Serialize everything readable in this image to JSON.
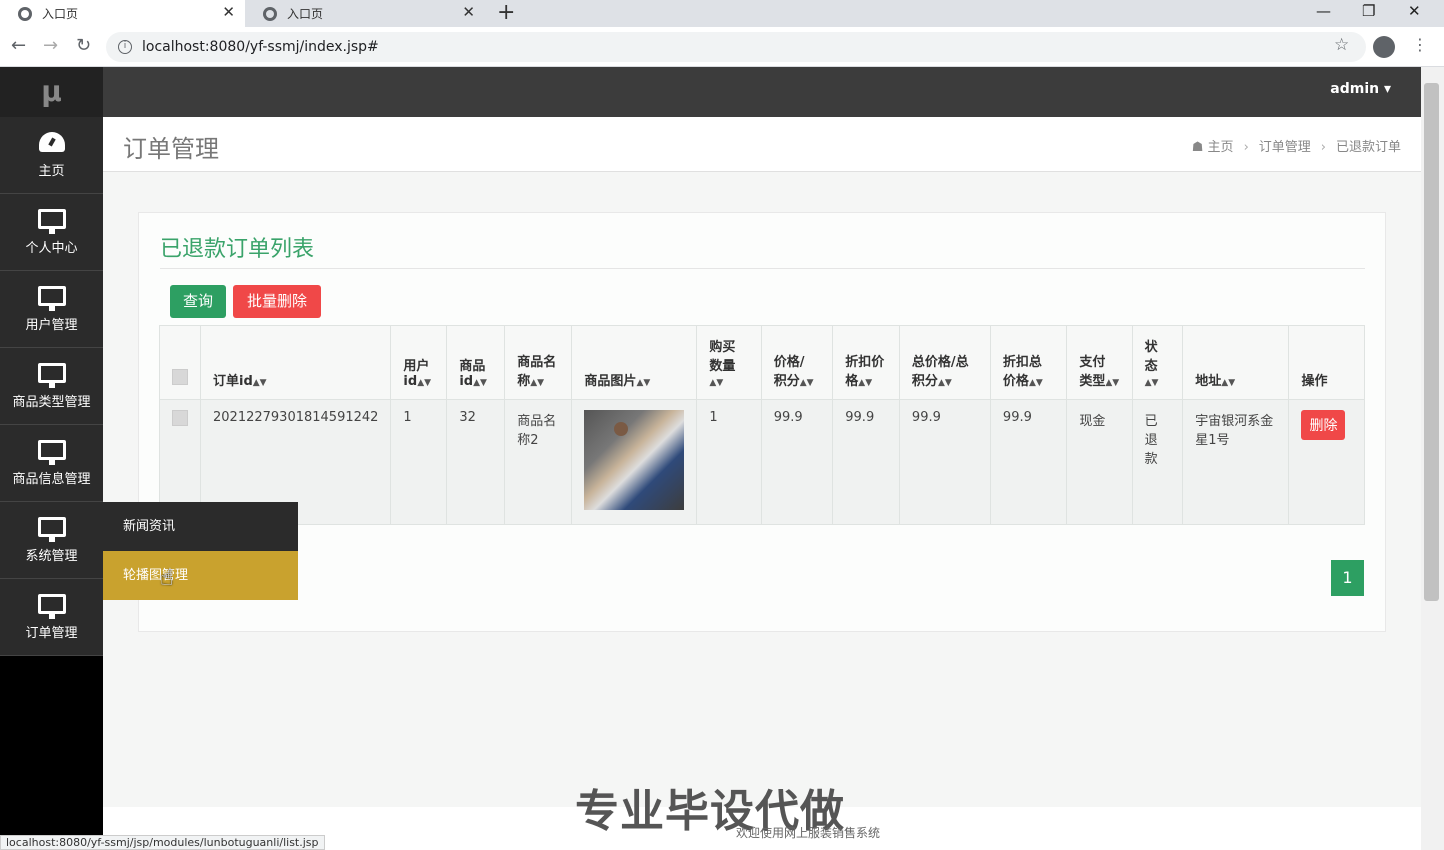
{
  "browser": {
    "tabs": [
      {
        "label": "入口页"
      },
      {
        "label": "入口页"
      }
    ],
    "url": "localhost:8080/yf-ssmj/index.jsp#",
    "status_url": "localhost:8080/yf-ssmj/jsp/modules/lunbotuguanli/list.jsp"
  },
  "sidebar": {
    "logo": "μ",
    "items": [
      {
        "label": "主页",
        "icon": "dashboard-icon"
      },
      {
        "label": "个人中心",
        "icon": "monitor-icon"
      },
      {
        "label": "用户管理",
        "icon": "monitor-icon"
      },
      {
        "label": "商品类型管理",
        "icon": "monitor-icon"
      },
      {
        "label": "商品信息管理",
        "icon": "monitor-icon"
      },
      {
        "label": "系统管理",
        "icon": "monitor-icon"
      },
      {
        "label": "订单管理",
        "icon": "monitor-icon"
      }
    ],
    "submenu": [
      {
        "label": "新闻资讯"
      },
      {
        "label": "轮播图管理"
      }
    ]
  },
  "topnav": {
    "user": "admin ▾"
  },
  "page": {
    "title": "订单管理",
    "breadcrumb": [
      "主页",
      "订单管理",
      "已退款订单"
    ]
  },
  "card": {
    "title": "已退款订单列表",
    "query_button": "查询",
    "batch_delete_button": "批量删除"
  },
  "table": {
    "headers": [
      {
        "l1": "订单id",
        "l2": ""
      },
      {
        "l1": "用户",
        "l2": "id"
      },
      {
        "l1": "商品",
        "l2": "id"
      },
      {
        "l1": "商品名",
        "l2": "称"
      },
      {
        "l1": "商品图片",
        "l2": ""
      },
      {
        "l1": "购买",
        "l2": "数量"
      },
      {
        "l1": "价格/",
        "l2": "积分"
      },
      {
        "l1": "折扣价",
        "l2": "格"
      },
      {
        "l1": "总价格/总",
        "l2": "积分"
      },
      {
        "l1": "折扣总",
        "l2": "价格"
      },
      {
        "l1": "支付",
        "l2": "类型"
      },
      {
        "l1": "状",
        "l2": "态"
      },
      {
        "l1": "地址",
        "l2": ""
      },
      {
        "l1": "操作",
        "l2": ""
      }
    ],
    "rows": [
      {
        "order_id": "20212279301814591242",
        "user_id": "1",
        "product_id": "32",
        "product_name": "商品名称2",
        "quantity": "1",
        "price": "99.9",
        "discount_price": "99.9",
        "total": "99.9",
        "discount_total": "99.9",
        "pay_type": "现金",
        "status": "已退款",
        "address": "宇宙银河系金星1号",
        "action": "删除"
      }
    ]
  },
  "pagination": {
    "current": "1"
  },
  "footer": {
    "watermark": "专业毕设代做",
    "welcome": "欢迎使用网上服装销售系统"
  }
}
